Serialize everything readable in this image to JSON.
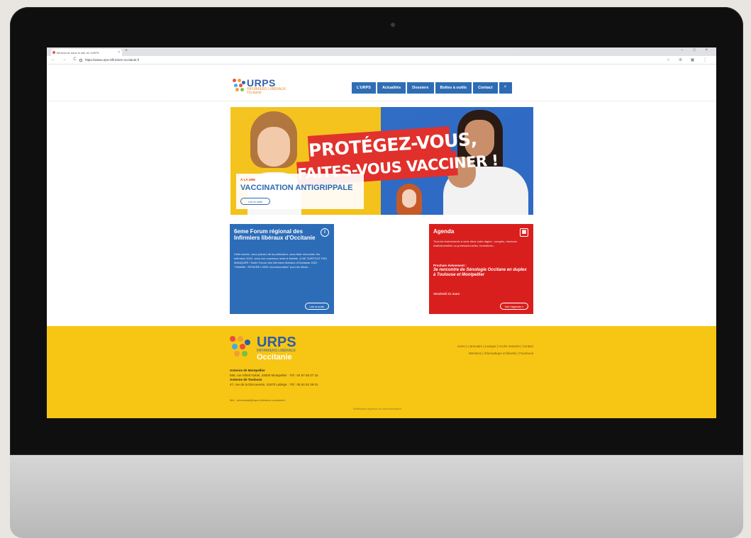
{
  "browser": {
    "tab_title": "Bienvenue dans le site de l'URPS",
    "tab_close": "×",
    "new_tab": "+",
    "window_controls": "– □ ×",
    "nav_buttons": "← → C",
    "url": "https://www.urps-infirmiere-occitanie.fr",
    "extensions": "☆ ⊕ ▣ ⋮"
  },
  "site": {
    "logo": {
      "name": "URPS",
      "subtitle": "INFIRMIERS LIBÉRAUX",
      "region": "Occitanie"
    },
    "nav": [
      "L'URPS",
      "Actualités",
      "Dossiers",
      "Boîtes à outils",
      "Contact"
    ],
    "search_glyph": "⌕"
  },
  "hero": {
    "slogan_line1": "PROTÉGEZ-VOUS,",
    "slogan_line2": "FAITES-VOUS VACCINER !",
    "kicker": "À LA UNE",
    "title": "VACCINATION ANTIGRIPPALE",
    "button": "Lire la suite"
  },
  "cards": {
    "forum": {
      "title": "6eme Forum régional des Infirmiers libéraux d'Occitanie",
      "icon": "i",
      "body": "Cette année, vous pouvez de la profession, vous faire rencontrer les infirmiers 2022, sous vos nouveaux mots le théâtre. À NE SURTOUT PAS MANQUER ! Notre Forum des Infirmiers libéraux d'Occitanie 2022 \"Visibilité : RENDRE L'IDEL incontournable\" pour les 6ème ... ",
      "button": "Lire la suite"
    },
    "agenda": {
      "title": "Agenda",
      "icon": "▦",
      "body": "Tous les évènements à venir dans votre région : congrès, réunions institutionnelles ou professionnelles, formations...",
      "next_label": "Prochain évènement :",
      "event": "3e rencontre de Sénologie Occitane en duplex à Toulouse et Montpellier",
      "date": "Vendredi 21 mars",
      "button": "Voir l'agenda »"
    }
  },
  "footer": {
    "logo": {
      "name": "URPS",
      "subtitle": "INFIRMIERS LIBÉRAUX",
      "region": "Occitanie"
    },
    "antenne1_label": "Antenne de Montpellier",
    "antenne1": "585, rue Alfred Nobel, 34000 Montpellier · Tél : 04 67 65 07 15",
    "antenne2_label": "Antenne de Toulouse",
    "antenne2": "47, rue de la Découverte, 31670 Labège · Tél : 05 62 62 39 01",
    "mail": "Mél : secretariat@urps-infirmiere-occitanie.fr",
    "links1": "Liens | L'annuaire | Lexique | Accès restreint | Contact",
    "links2": "Mentions | Informatique et libertés | Facebook",
    "credit": "Réalisation Agence de communication"
  },
  "colors": {
    "brand_blue": "#2b6ab3",
    "agenda_red": "#d91f1e",
    "footer_yellow": "#f7c513",
    "hero_red": "#e1302b"
  }
}
